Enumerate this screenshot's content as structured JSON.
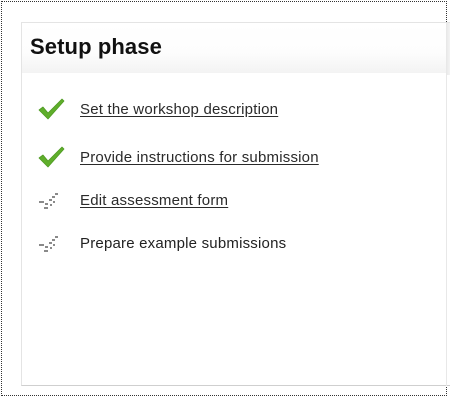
{
  "phase": {
    "title": "Setup phase",
    "tasks": [
      {
        "label": "Set the workshop description",
        "status": "done",
        "icon": "checkmark-icon",
        "link": true
      },
      {
        "label": "Provide instructions for submission",
        "status": "done",
        "icon": "checkmark-icon",
        "link": true
      },
      {
        "label": "Edit assessment form",
        "status": "todo",
        "icon": "pending-check-icon",
        "link": true
      },
      {
        "label": "Prepare example submissions",
        "status": "todo",
        "icon": "pending-check-icon",
        "link": false
      }
    ]
  },
  "colors": {
    "done_check": "#5fae2b",
    "pending_check": "#8a8a8a",
    "text": "#222222"
  }
}
